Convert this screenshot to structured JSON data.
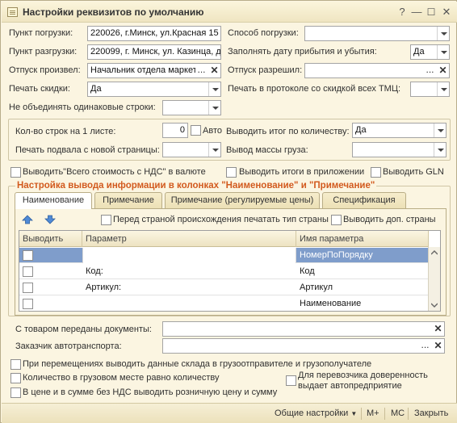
{
  "window": {
    "title": "Настройки реквизитов по умолчанию"
  },
  "fields": {
    "punkt_pogruzki": {
      "label": "Пункт погрузки:",
      "value": "220026, г.Минск, ул.Красная 15"
    },
    "punkt_razgruzki": {
      "label": "Пункт разгрузки:",
      "value": "220099, г. Минск, ул. Казинца, д"
    },
    "otpusk_proizvel": {
      "label": "Отпуск произвел:",
      "value": "Начальник отдела маркет"
    },
    "pechat_skidki": {
      "label": "Печать скидки:",
      "value": "Да"
    },
    "ne_obedinyat": {
      "label": "Не объединять одинаковые строки:",
      "value": ""
    },
    "sposob_pogruzki": {
      "label": "Способ погрузки:",
      "value": ""
    },
    "zapolnyat_datu": {
      "label": "Заполнять дату прибытия и убытия:",
      "value": "Да"
    },
    "otpusk_razreshil": {
      "label": "Отпуск разрешил:",
      "value": ""
    },
    "pechat_protokole": {
      "label": "Печать в протоколе со скидкой всех ТМЦ:",
      "value": ""
    }
  },
  "pagegroup": {
    "kol_strok": {
      "label": "Кол-во строк на 1 листе:",
      "value": "0"
    },
    "avto": {
      "label": "Авто"
    },
    "pechat_podvala": {
      "label": "Печать подвала с новой страницы:",
      "value": ""
    },
    "itog_kolichestvo": {
      "label": "Выводить итог по количеству:",
      "value": "Да"
    },
    "massa_gruza": {
      "label": "Вывод массы груза:",
      "value": ""
    }
  },
  "checks_row": {
    "vsego_nds": "Выводить\"Всего стоимость с НДС\" в валюте",
    "itogi_prilozhenii": "Выводить итоги в приложении",
    "gln": "Выводить GLN"
  },
  "columns_group": {
    "title": "Настройка вывода информации в колонках \"Наименование\" и \"Примечание\"",
    "tabs": [
      "Наименование",
      "Примечание",
      "Примечание (регулируемые цены)",
      "Спецификация"
    ],
    "check_strana": "Перед страной происхождения печатать тип страны",
    "check_dop_strany": "Выводить доп. страны",
    "table": {
      "headers": [
        "Выводить",
        "Параметр",
        "Имя параметра"
      ],
      "rows": [
        {
          "param": "",
          "name": "НомерПоПорядку"
        },
        {
          "param": "Код:",
          "name": "Код"
        },
        {
          "param": "Артикул:",
          "name": "Артикул"
        },
        {
          "param": "",
          "name": "Наименование"
        }
      ]
    }
  },
  "lower_fields": {
    "dokumenty": {
      "label": "С товаром переданы документы:",
      "value": ""
    },
    "zakazchik": {
      "label": "Заказчик автотранспорта:",
      "value": ""
    }
  },
  "bottom_checks": {
    "peremeshenie": "При перемещениях выводить данные склада в грузоотправителе и грузополучателе",
    "kolichestvo_gruz": "Количество в грузовом месте равно количеству",
    "roznichnaya": "В цене и в сумме без НДС выводить розничную цену и сумму",
    "perevozchik_line1": "Для перевозчика доверенность",
    "perevozchik_line2": "выдает автопредприятие"
  },
  "footer": {
    "obshie": "Общие настройки",
    "mplus": "M+",
    "mc": "MC",
    "zakryt": "Закрыть"
  },
  "icons": [
    "window-icon",
    "help-icon",
    "minimize-icon",
    "maximize-icon",
    "close-icon",
    "move-up-icon",
    "move-down-icon"
  ],
  "colors": {
    "window_bg": "#fbf5e1",
    "group_title": "#d25a1e",
    "selected_row": "#7f9dcb"
  }
}
